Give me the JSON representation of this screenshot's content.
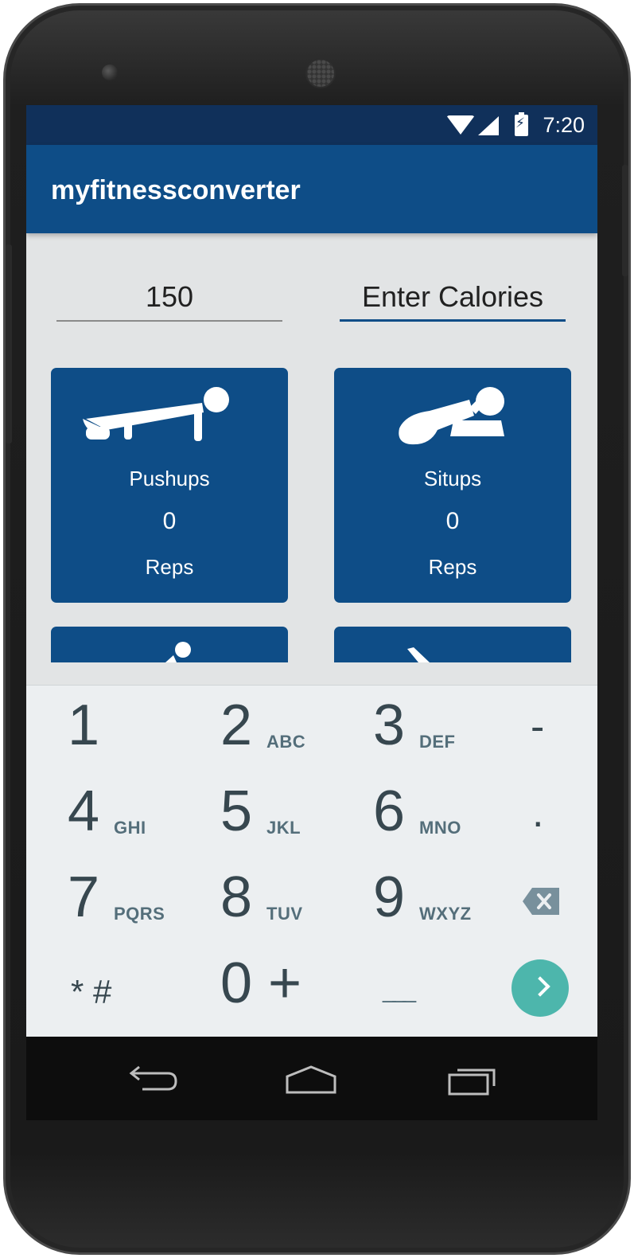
{
  "status_bar": {
    "time": "7:20",
    "icons": [
      "wifi-icon",
      "cell-signal-icon",
      "battery-charging-icon"
    ]
  },
  "app_bar": {
    "title": "myfitnessconverter"
  },
  "inputs": {
    "weight_value": "150",
    "calories_placeholder": "Enter Calories"
  },
  "cards": [
    {
      "icon": "pushup-icon",
      "label": "Pushups",
      "value": "0",
      "unit": "Reps"
    },
    {
      "icon": "situp-icon",
      "label": "Situps",
      "value": "0",
      "unit": "Reps"
    }
  ],
  "keypad": {
    "keys": [
      {
        "digit": "1",
        "letters": ""
      },
      {
        "digit": "2",
        "letters": "ABC"
      },
      {
        "digit": "3",
        "letters": "DEF"
      },
      {
        "digit": "-",
        "letters": ""
      },
      {
        "digit": "4",
        "letters": "GHI"
      },
      {
        "digit": "5",
        "letters": "JKL"
      },
      {
        "digit": "6",
        "letters": "MNO"
      },
      {
        "digit": ".",
        "letters": ""
      },
      {
        "digit": "7",
        "letters": "PQRS"
      },
      {
        "digit": "8",
        "letters": "TUV"
      },
      {
        "digit": "9",
        "letters": "WXYZ"
      },
      {
        "digit": "* #",
        "letters": ""
      },
      {
        "digit": "0 +",
        "letters": ""
      }
    ],
    "space_key": "___",
    "icons": [
      "backspace-icon",
      "next-arrow-icon"
    ]
  },
  "colors": {
    "primary": "#0e4d87",
    "status_bar": "#10305a",
    "screen_bg": "#e2e4e5",
    "keypad_bg": "#eceff1",
    "accent": "#4db6ac"
  },
  "nav_bar": {
    "icons": [
      "back-icon",
      "home-icon",
      "recents-icon"
    ]
  }
}
